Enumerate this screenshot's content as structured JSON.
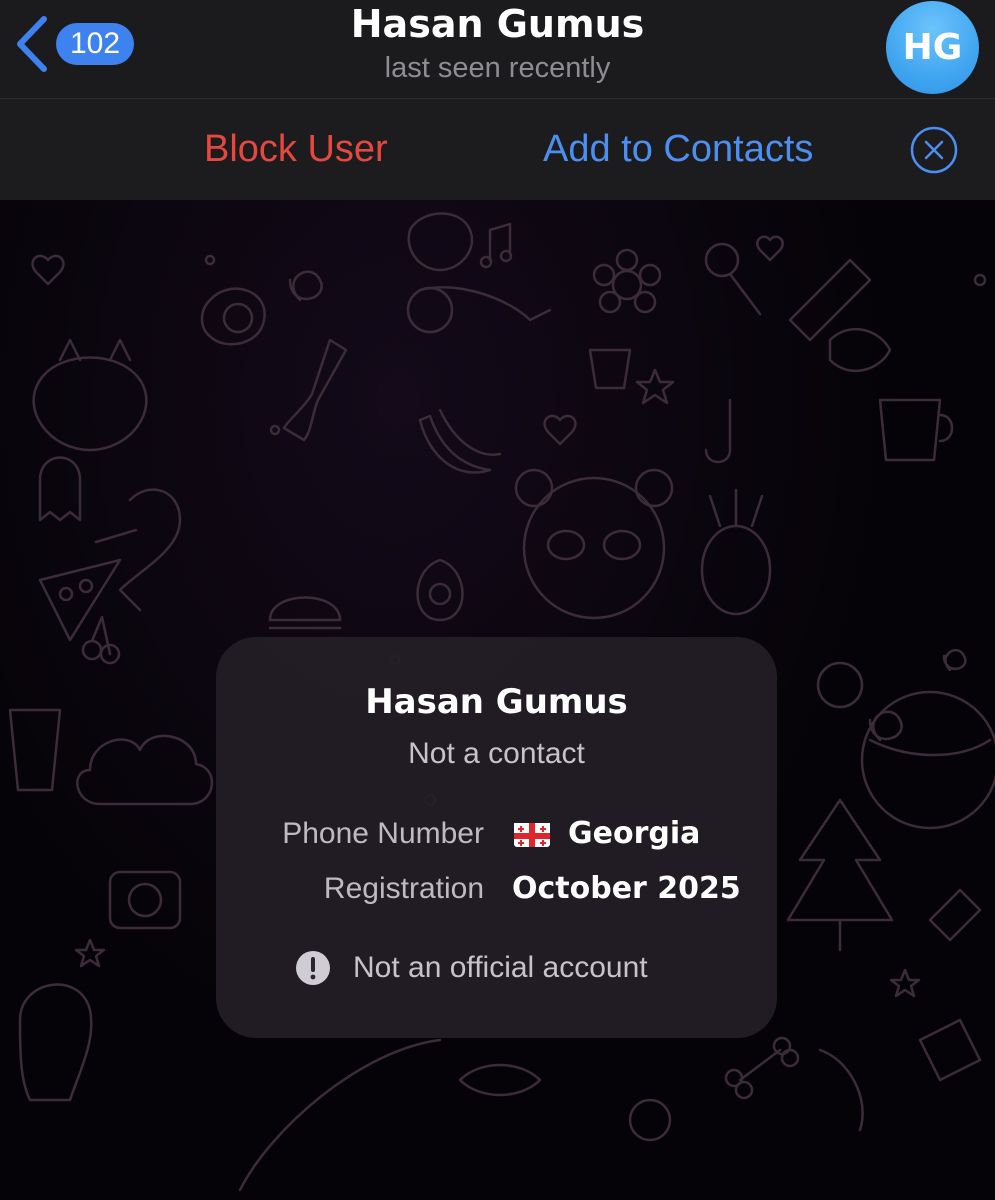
{
  "nav": {
    "back_icon": "chevron-left-icon",
    "unread_count": "102",
    "title": "Hasan Gumus",
    "subtitle": "last seen recently",
    "avatar_initials": "HG",
    "avatar_color": "#41a6f0"
  },
  "actions": {
    "block_label": "Block User",
    "add_label": "Add to Contacts",
    "close_icon": "close-circle-icon",
    "block_color": "#e5483e",
    "add_color": "#4c8ff0"
  },
  "card": {
    "name": "Hasan Gumus",
    "status": "Not a contact",
    "rows": [
      {
        "label": "Phone Number",
        "value": "Georgia",
        "icon": "georgia-flag-icon"
      },
      {
        "label": "Registration",
        "value": "October 2025"
      }
    ],
    "notice": "Not an official account",
    "notice_icon": "exclamation-circle-icon"
  }
}
